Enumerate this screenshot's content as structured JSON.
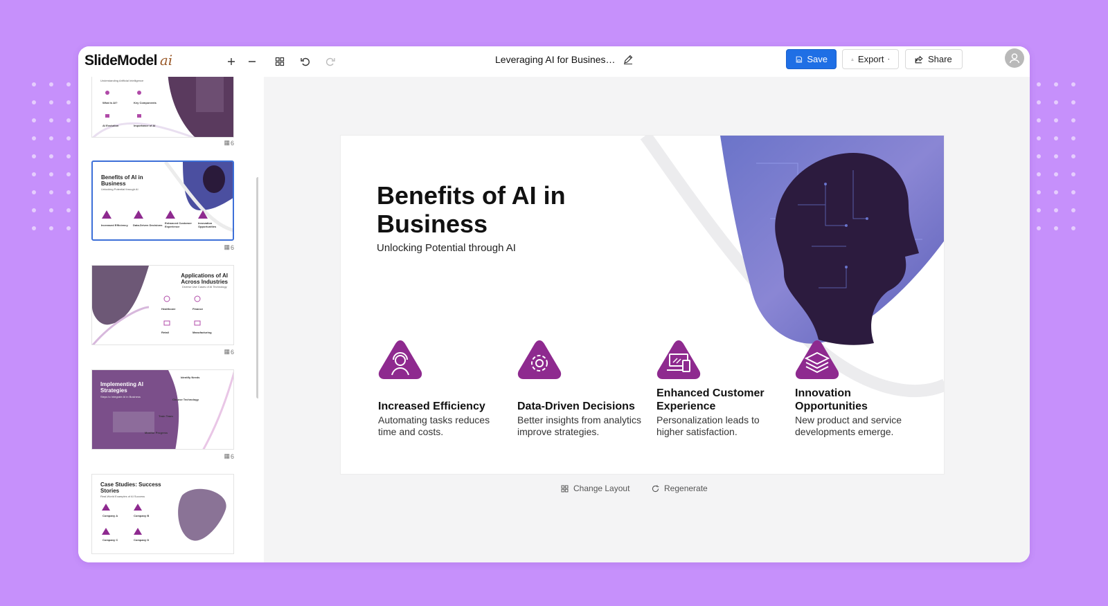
{
  "app": {
    "brand": "SlideModel",
    "brand_suffix": "ai"
  },
  "toolbar": {
    "doc_title": "Leveraging AI for Busines…",
    "save_label": "Save",
    "export_label": "Export",
    "share_label": "Share"
  },
  "sidebar": {
    "thumbnails": [
      {
        "count": "6",
        "title": "",
        "subtitle": "Understanding Artificial Intelligence",
        "items": [
          "What is AI?",
          "Key Components",
          "AI Evolution",
          "Importance of AI"
        ]
      },
      {
        "count": "6",
        "title": "Benefits of AI in Business",
        "subtitle": "Unlocking Potential through AI",
        "items": [
          "Increased Efficiency",
          "Data-Driven Decisions",
          "Enhanced Customer Experience",
          "Innovation Opportunities"
        ]
      },
      {
        "count": "6",
        "title": "Applications of AI Across Industries",
        "subtitle": "Diverse Use Cases of AI Technology",
        "items": [
          "Healthcare",
          "Finance",
          "Retail",
          "Manufacturing"
        ]
      },
      {
        "count": "6",
        "title": "Implementing AI Strategies",
        "subtitle": "Steps to Integrate AI in Business",
        "items": [
          "Identify Needs",
          "Choose Technology",
          "Train Team",
          "Monitor Progress"
        ]
      },
      {
        "count": "",
        "title": "Case Studies: Success Stories",
        "subtitle": "Real-World Examples of AI Success",
        "items": [
          "Company A",
          "Company B",
          "Company C",
          "Company D"
        ]
      }
    ]
  },
  "slide": {
    "title": "Benefits of AI in Business",
    "subtitle": "Unlocking Potential through AI",
    "features": [
      {
        "icon": "support-agent-icon",
        "name": "Increased Efficiency",
        "desc": "Automating tasks reduces time and costs."
      },
      {
        "icon": "gear-icon",
        "name": "Data-Driven Decisions",
        "desc": "Better insights from analytics improve strategies."
      },
      {
        "icon": "devices-icon",
        "name": "Enhanced Customer Experience",
        "desc": "Personalization leads to higher satisfaction."
      },
      {
        "icon": "layers-icon",
        "name": "Innovation Opportunities",
        "desc": "New product and service developments emerge."
      }
    ]
  },
  "actions": {
    "change_layout": "Change Layout",
    "regenerate": "Regenerate"
  },
  "colors": {
    "background": "#c690fb",
    "accent_purple": "#8e2a8f",
    "save_blue": "#1f6fe5"
  }
}
